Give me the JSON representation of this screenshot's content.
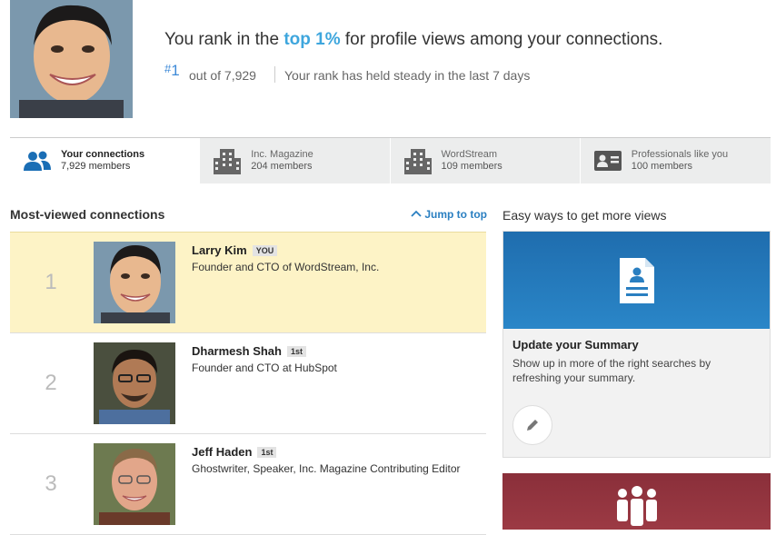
{
  "header": {
    "headline_pre": "You rank in the ",
    "headline_highlight": "top 1%",
    "headline_post": " for profile views among your connections.",
    "rank_hash": "#",
    "rank_value": "1",
    "rank_out_of": "out of 7,929",
    "rank_status": "Your rank has held steady in the last 7 days"
  },
  "tabs": [
    {
      "title": "Your connections",
      "sub": "7,929 members",
      "icon": "people-icon",
      "active": true
    },
    {
      "title": "Inc. Magazine",
      "sub": "204 members",
      "icon": "building-icon"
    },
    {
      "title": "WordStream",
      "sub": "109 members",
      "icon": "building-icon"
    },
    {
      "title": "Professionals like you",
      "sub": "100 members",
      "icon": "id-card-icon"
    }
  ],
  "list": {
    "title": "Most-viewed connections",
    "jump_label": "Jump to top",
    "rows": [
      {
        "rank": "1",
        "name": "Larry Kim",
        "badge": "YOU",
        "title": "Founder and CTO of WordStream, Inc."
      },
      {
        "rank": "2",
        "name": "Dharmesh Shah",
        "badge": "1st",
        "title": "Founder and CTO at HubSpot"
      },
      {
        "rank": "3",
        "name": "Jeff Haden",
        "badge": "1st",
        "title": "Ghostwriter, Speaker, Inc. Magazine Contributing Editor"
      }
    ]
  },
  "side": {
    "title": "Easy ways to get more views",
    "card_heading": "Update your Summary",
    "card_text": "Show up in more of the right searches by refreshing your summary."
  },
  "colors": {
    "accent": "#3ea6dd",
    "highlight_row": "#fdf3c6",
    "card_blue": "#2a7fc1",
    "card_red": "#8a2f3a"
  }
}
